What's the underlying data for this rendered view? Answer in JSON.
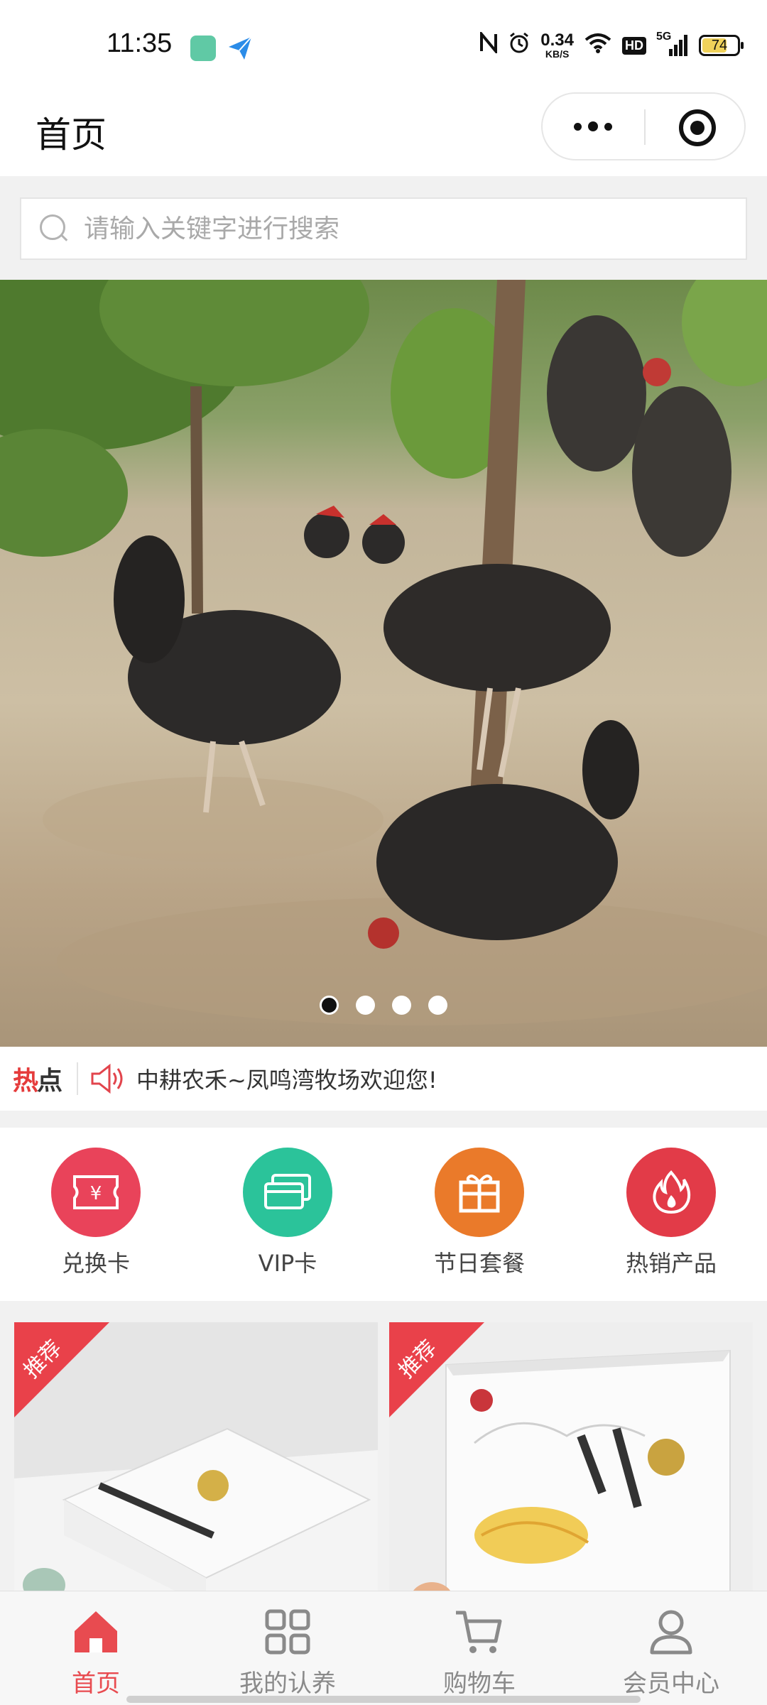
{
  "status_bar": {
    "time": "11:35",
    "net_speed_value": "0.34",
    "net_speed_unit": "KB/S",
    "hd": "HD",
    "signal": "5G",
    "battery": "74",
    "battery_level": 0.74
  },
  "header": {
    "title": "首页"
  },
  "search": {
    "placeholder": "请输入关键字进行搜索",
    "value": ""
  },
  "banner": {
    "slide_count": 4,
    "active_index": 0
  },
  "hot": {
    "logo_first": "热",
    "logo_second": "点",
    "text": "中耕农禾~凤鸣湾牧场欢迎您!"
  },
  "categories": [
    {
      "label": "兑换卡",
      "color": "#e9435a",
      "icon": "exchange-card-icon"
    },
    {
      "label": "VIP卡",
      "color": "#2bc39a",
      "icon": "vip-card-icon"
    },
    {
      "label": "节日套餐",
      "color": "#ea7a2a",
      "icon": "gift-box-icon"
    },
    {
      "label": "热销产品",
      "color": "#e23b48",
      "icon": "fire-icon"
    }
  ],
  "products": [
    {
      "badge": "推荐"
    },
    {
      "badge": "推荐"
    }
  ],
  "tabbar": [
    {
      "label": "首页",
      "icon": "home-icon",
      "active": true
    },
    {
      "label": "我的认养",
      "icon": "grid-icon",
      "active": false
    },
    {
      "label": "购物车",
      "icon": "cart-icon",
      "active": false
    },
    {
      "label": "会员中心",
      "icon": "user-icon",
      "active": false
    }
  ],
  "colors": {
    "accent": "#e84b50",
    "badge": "#e9414a"
  }
}
